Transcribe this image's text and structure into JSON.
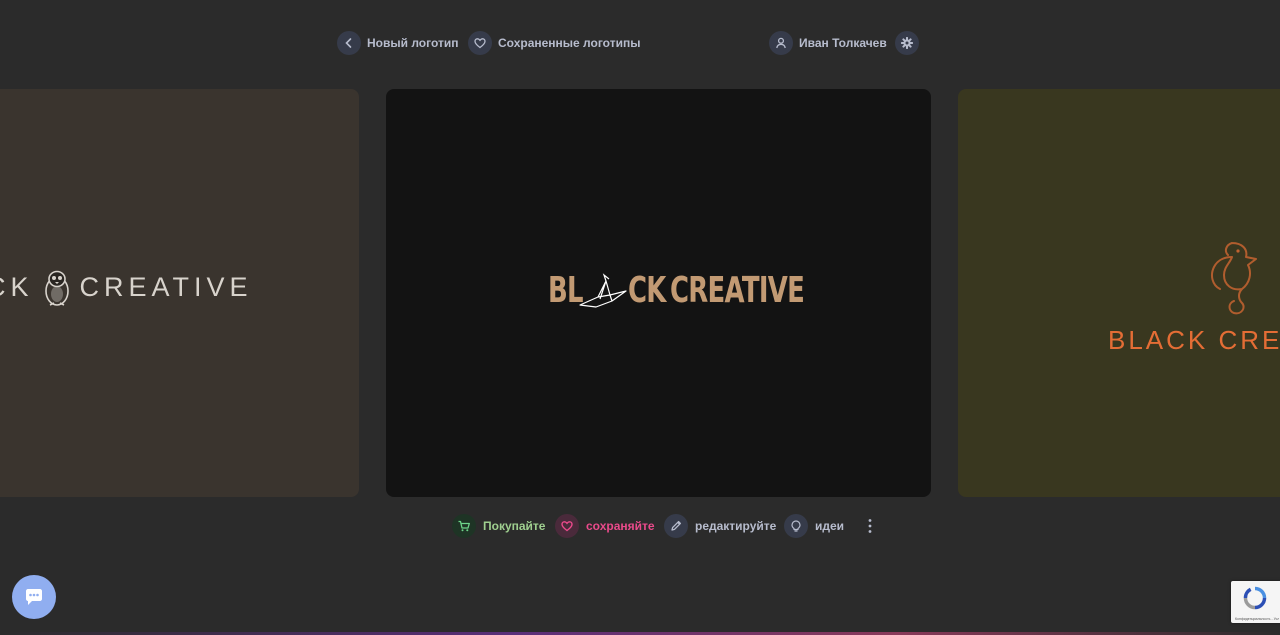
{
  "nav": {
    "back_label": "Новый логотип",
    "saved_label": "Сохраненные логотипы",
    "user_name": "Иван Толкачев"
  },
  "cards": {
    "left": {
      "logo_text_a": "CK",
      "logo_text_b": "CREATIVE",
      "background": "#3a342e"
    },
    "center": {
      "logo_part_1": "BL",
      "logo_part_2": "CK",
      "logo_part_3": "CREATIVE",
      "logo_color": "#c29a73",
      "background": "#131313"
    },
    "right": {
      "logo_text": "BLACK CREA",
      "logo_color": "#e46d35",
      "background": "#39371f"
    }
  },
  "actions": {
    "buy_label": "Покупайте",
    "save_label": "сохраняйте",
    "edit_label": "редактируйте",
    "ideas_label": "идеи"
  },
  "recaptcha": {
    "text": "Конфиденциальность - Условия использования"
  },
  "colors": {
    "background": "#2b2b2b",
    "buy": "#9fcf8f",
    "save": "#ea4a8b",
    "chat": "#90aef0"
  },
  "icons": {
    "back": "chevron-left-icon",
    "saved": "heart-icon",
    "user": "user-icon",
    "settings": "gear-icon",
    "buy": "cart-icon",
    "save": "heart-icon",
    "edit": "pencil-icon",
    "ideas": "lightbulb-icon",
    "more": "more-vertical-icon",
    "chat": "chat-icon"
  }
}
